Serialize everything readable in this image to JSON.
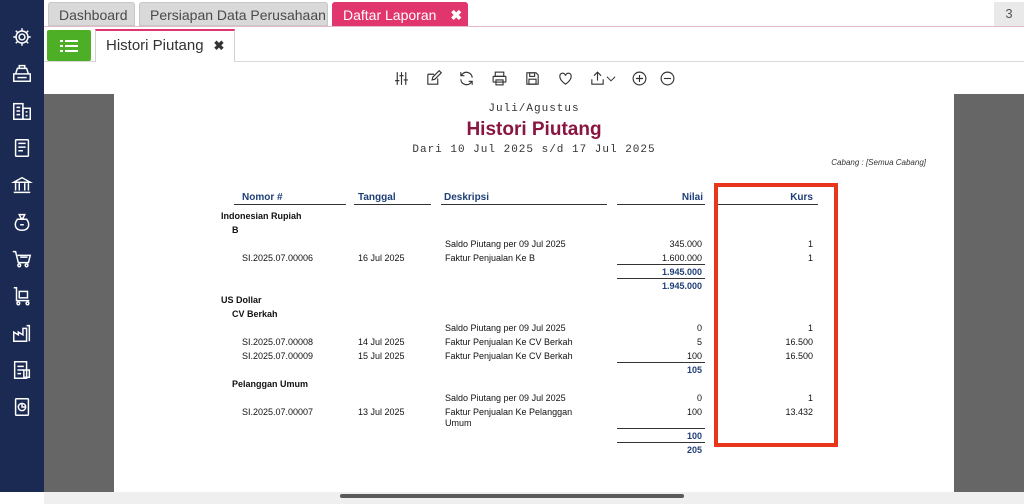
{
  "tabs": [
    {
      "label": "Dashboard",
      "active": false
    },
    {
      "label": "Persiapan Data Perusahaan",
      "active": false
    },
    {
      "label": "Daftar Laporan",
      "active": true
    }
  ],
  "tab_close": "✖",
  "tab_counter": "3",
  "subtab": {
    "label": "Histori Piutang",
    "close": "✖"
  },
  "sidebar": {
    "icons": [
      "settings-icon",
      "cash-register-icon",
      "buildings-icon",
      "ledger-book-icon",
      "bank-icon",
      "money-bag-icon",
      "shopping-cart-icon",
      "cart-box-icon",
      "factory-icon",
      "tax-document-icon",
      "report-icon"
    ]
  },
  "toolbar": {
    "icons": [
      "filter-sliders-icon",
      "edit-icon",
      "refresh-icon",
      "print-icon",
      "save-icon",
      "favorite-heart-icon",
      "export-icon",
      "chevron-down-icon",
      "zoom-in-icon",
      "zoom-out-icon"
    ]
  },
  "report": {
    "period": "Juli/Agustus",
    "title": "Histori Piutang",
    "range": "Dari 10 Jul 2025 s/d 17 Jul 2025",
    "branch": "Cabang : [Semua Cabang]",
    "columns": {
      "nomor": "Nomor #",
      "tanggal": "Tanggal",
      "deskripsi": "Deskripsi",
      "nilai": "Nilai",
      "kurs": "Kurs"
    },
    "groups": {
      "idr": {
        "currency": "Indonesian Rupiah",
        "customer_b": {
          "name": "B",
          "rows": [
            {
              "nomor": "",
              "tanggal": "",
              "deskripsi": "Saldo Piutang per 09 Jul 2025",
              "nilai": "345.000",
              "kurs": "1"
            },
            {
              "nomor": "SI.2025.07.00006",
              "tanggal": "16 Jul 2025",
              "deskripsi": "Faktur Penjualan Ke B",
              "nilai": "1.600.000",
              "kurs": "1"
            }
          ],
          "subtotal": "1.945.000"
        },
        "total": "1.945.000"
      },
      "usd": {
        "currency": "US Dollar",
        "customer_cv": {
          "name": "CV Berkah",
          "rows": [
            {
              "nomor": "",
              "tanggal": "",
              "deskripsi": "Saldo Piutang per 09 Jul 2025",
              "nilai": "0",
              "kurs": "1"
            },
            {
              "nomor": "SI.2025.07.00008",
              "tanggal": "14 Jul 2025",
              "deskripsi": "Faktur Penjualan Ke CV Berkah",
              "nilai": "5",
              "kurs": "16.500"
            },
            {
              "nomor": "SI.2025.07.00009",
              "tanggal": "15 Jul 2025",
              "deskripsi": "Faktur Penjualan Ke CV Berkah",
              "nilai": "100",
              "kurs": "16.500"
            }
          ],
          "subtotal": "105"
        },
        "customer_umum": {
          "name": "Pelanggan Umum",
          "rows": [
            {
              "nomor": "",
              "tanggal": "",
              "deskripsi": "Saldo Piutang per 09 Jul 2025",
              "nilai": "0",
              "kurs": "1"
            },
            {
              "nomor": "SI.2025.07.00007",
              "tanggal": "13 Jul 2025",
              "deskripsi": "Faktur Penjualan Ke Pelanggan",
              "deskripsi2": "Umum",
              "nilai": "100",
              "kurs": "13.432"
            }
          ],
          "subtotal": "100"
        },
        "total": "205"
      }
    }
  },
  "colors": {
    "nav": "#1b2a52",
    "accent": "#e0356d",
    "title": "#8a1540",
    "header_blue": "#1f3f78",
    "highlight": "#e8361d",
    "list_button": "#4caf25"
  }
}
